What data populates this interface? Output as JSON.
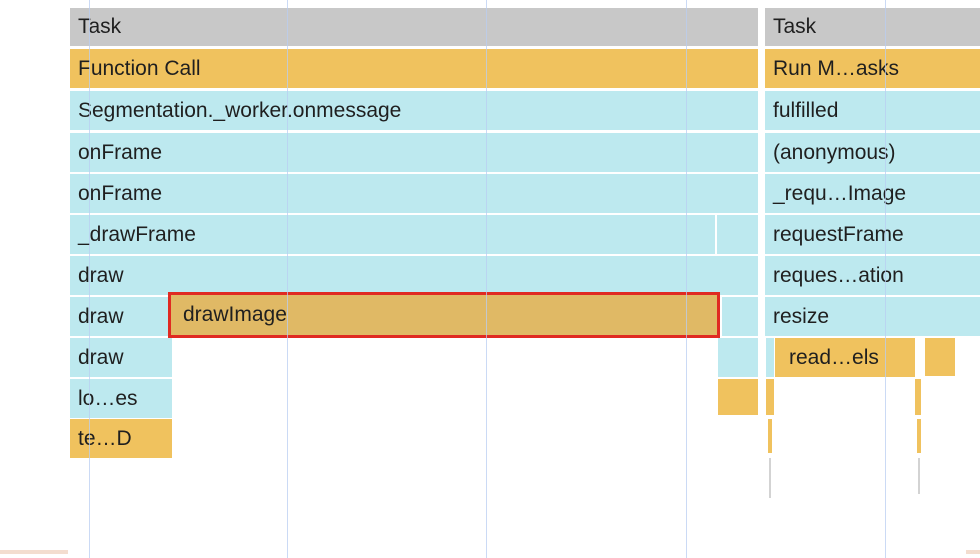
{
  "left": {
    "task_label": "Task",
    "function_call_label": "Function Call",
    "rows": [
      "Segmentation._worker.onmessage",
      "onFrame",
      "onFrame",
      "_drawFrame",
      "draw",
      "draw",
      "draw",
      "lo…es",
      "te…D"
    ],
    "selected_label": "drawImage"
  },
  "right": {
    "task_label": "Task",
    "rows": [
      "Run M…asks",
      "fulfilled",
      "(anonymous)",
      "_requ…Image",
      "requestFrame",
      "reques…ation",
      "resize",
      "read…els"
    ]
  },
  "colors": {
    "task": "#c8c8c8",
    "function_call": "#f0c25e",
    "js_frame": "#bde9ef",
    "selection_border": "#e02a22",
    "grid": "#b9cdf2"
  }
}
